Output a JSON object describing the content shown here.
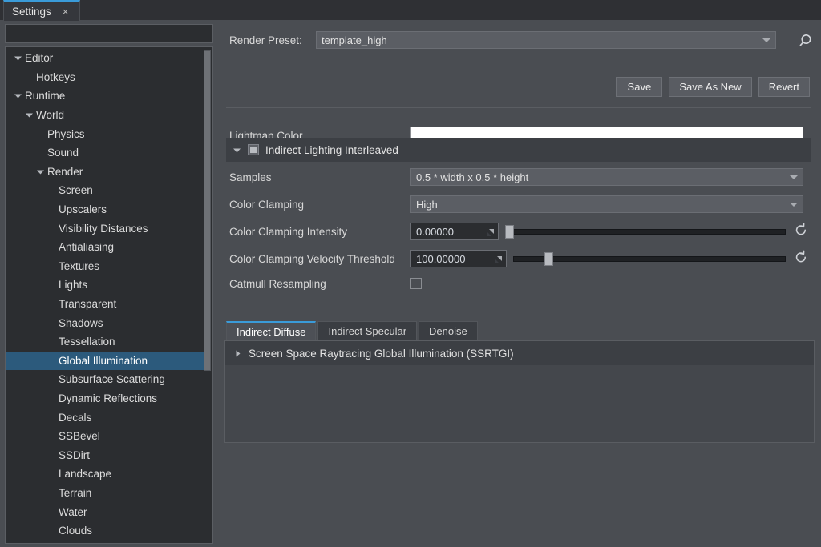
{
  "window": {
    "tab_label": "Settings",
    "tab_close": "×"
  },
  "sidebar": {
    "filter_placeholder": "",
    "filter_value": "",
    "items": [
      {
        "label": "Editor",
        "depth": 0,
        "twisty": "down",
        "selected": false
      },
      {
        "label": "Hotkeys",
        "depth": 1,
        "twisty": "none",
        "selected": false
      },
      {
        "label": "Runtime",
        "depth": 0,
        "twisty": "down",
        "selected": false
      },
      {
        "label": "World",
        "depth": 1,
        "twisty": "down",
        "selected": false
      },
      {
        "label": "Physics",
        "depth": 2,
        "twisty": "none",
        "selected": false
      },
      {
        "label": "Sound",
        "depth": 2,
        "twisty": "none",
        "selected": false
      },
      {
        "label": "Render",
        "depth": 2,
        "twisty": "down",
        "selected": false
      },
      {
        "label": "Screen",
        "depth": 3,
        "twisty": "none",
        "selected": false
      },
      {
        "label": "Upscalers",
        "depth": 3,
        "twisty": "none",
        "selected": false
      },
      {
        "label": "Visibility Distances",
        "depth": 3,
        "twisty": "none",
        "selected": false
      },
      {
        "label": "Antialiasing",
        "depth": 3,
        "twisty": "none",
        "selected": false
      },
      {
        "label": "Textures",
        "depth": 3,
        "twisty": "none",
        "selected": false
      },
      {
        "label": "Lights",
        "depth": 3,
        "twisty": "none",
        "selected": false
      },
      {
        "label": "Transparent",
        "depth": 3,
        "twisty": "none",
        "selected": false
      },
      {
        "label": "Shadows",
        "depth": 3,
        "twisty": "none",
        "selected": false
      },
      {
        "label": "Tessellation",
        "depth": 3,
        "twisty": "none",
        "selected": false
      },
      {
        "label": "Global Illumination",
        "depth": 3,
        "twisty": "none",
        "selected": true
      },
      {
        "label": "Subsurface Scattering",
        "depth": 3,
        "twisty": "none",
        "selected": false
      },
      {
        "label": "Dynamic Reflections",
        "depth": 3,
        "twisty": "none",
        "selected": false
      },
      {
        "label": "Decals",
        "depth": 3,
        "twisty": "none",
        "selected": false
      },
      {
        "label": "SSBevel",
        "depth": 3,
        "twisty": "none",
        "selected": false
      },
      {
        "label": "SSDirt",
        "depth": 3,
        "twisty": "none",
        "selected": false
      },
      {
        "label": "Landscape",
        "depth": 3,
        "twisty": "none",
        "selected": false
      },
      {
        "label": "Terrain",
        "depth": 3,
        "twisty": "none",
        "selected": false
      },
      {
        "label": "Water",
        "depth": 3,
        "twisty": "none",
        "selected": false
      },
      {
        "label": "Clouds",
        "depth": 3,
        "twisty": "none",
        "selected": false
      }
    ]
  },
  "preset": {
    "label": "Render Preset:",
    "value": "template_high",
    "search_icon": "magnifier-icon",
    "dropdown_icon": "chevron-down-icon"
  },
  "actions": {
    "save": "Save",
    "save_as_new": "Save As New",
    "revert": "Revert"
  },
  "lightmap": {
    "label": "Lightmap Color",
    "color": "#ffffff"
  },
  "group": {
    "label": "Indirect Lighting Interleaved",
    "checkbox_state": "partial",
    "expanded": true
  },
  "fields": {
    "samples": {
      "label": "Samples",
      "value": "0.5 * width x 0.5 * height"
    },
    "color_clamping": {
      "label": "Color Clamping",
      "value": "High"
    },
    "color_clamping_intensity": {
      "label": "Color Clamping Intensity",
      "value": "0.00000",
      "slider_percent": 0
    },
    "color_clamping_velocity_threshold": {
      "label": "Color Clamping Velocity Threshold",
      "value": "100.00000",
      "slider_percent": 12
    },
    "catmull_resampling": {
      "label": "Catmull Resampling",
      "checked": false
    }
  },
  "inner_tabs": [
    {
      "label": "Indirect Diffuse",
      "active": true
    },
    {
      "label": "Indirect Specular",
      "active": false
    },
    {
      "label": "Denoise",
      "active": false
    }
  ],
  "ssrtgi": {
    "label": "Screen Space Raytracing Global Illumination (SSRTGI)",
    "expanded": false,
    "twisty": "right"
  },
  "colors": {
    "accent": "#3a9bd9",
    "selection": "#2c5a7c",
    "panel": "#4a4d52",
    "dark_panel": "#2b2d30",
    "group_header": "#3c3f44"
  }
}
